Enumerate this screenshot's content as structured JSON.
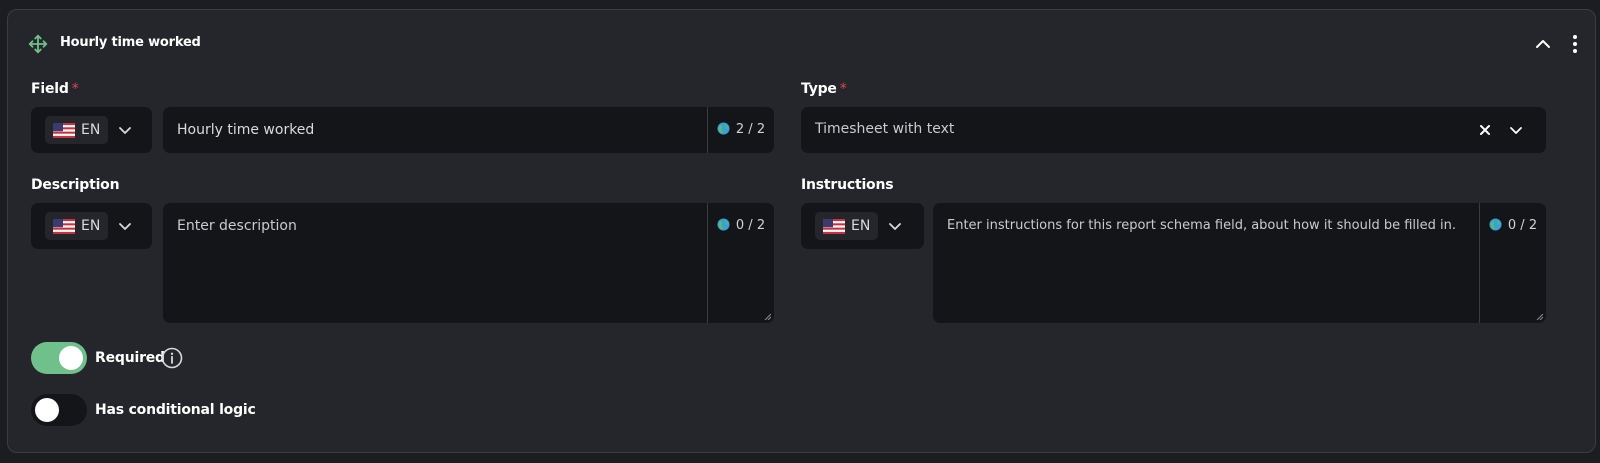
{
  "card": {
    "title": "Hourly time worked"
  },
  "field": {
    "label": "Field",
    "required_mark": "*",
    "lang_code": "EN",
    "value": "Hourly time worked",
    "counter": "2 / 2"
  },
  "type": {
    "label": "Type",
    "required_mark": "*",
    "value": "Timesheet with text"
  },
  "description": {
    "label": "Description",
    "lang_code": "EN",
    "placeholder": "Enter description",
    "counter": "0 / 2"
  },
  "instructions": {
    "label": "Instructions",
    "lang_code": "EN",
    "placeholder": "Enter instructions for this report schema field, about how it should be filled in.",
    "counter": "0 / 2"
  },
  "toggles": {
    "required": {
      "label": "Required",
      "on": true
    },
    "conditional": {
      "label": "Has conditional logic",
      "on": false
    }
  },
  "colors": {
    "accent_green": "#6fc08a",
    "required_star": "#e0454f",
    "card_bg": "#25262b",
    "input_bg": "#141518"
  },
  "icons": {
    "drag": "move-arrows-icon",
    "collapse": "chevron-up-icon",
    "menu": "vertical-dots-icon",
    "flag": "us-flag-icon",
    "globe": "globe-icon",
    "clear": "x-icon",
    "dropdown": "chevron-down-icon",
    "info": "info-circle-icon"
  }
}
